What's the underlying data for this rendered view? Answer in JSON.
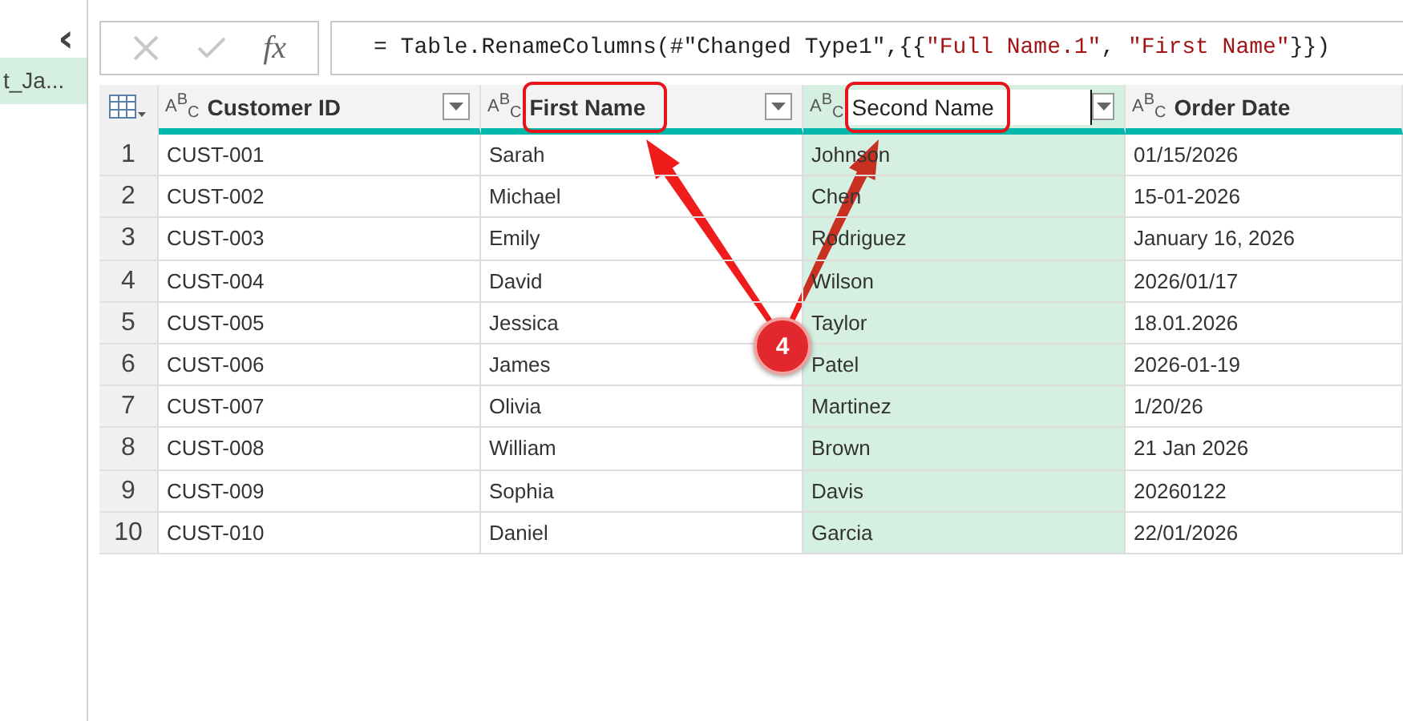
{
  "queries_pane": {
    "collapse_button": "‹",
    "items": [
      {
        "label": "t_Ja...",
        "selected": true
      }
    ]
  },
  "formula_bar": {
    "cancel": {
      "disabled": true
    },
    "commit": {
      "disabled": true
    },
    "fx_label": "fx",
    "formula": [
      {
        "kind": "code",
        "text": "= Table.RenameColumns(#\"Changed Type1\",{{"
      },
      {
        "kind": "string",
        "text": "\"Full Name.1\""
      },
      {
        "kind": "code",
        "text": ", "
      },
      {
        "kind": "string",
        "text": "\"First Name\""
      },
      {
        "kind": "code",
        "text": "}})"
      }
    ]
  },
  "table": {
    "columns": [
      {
        "name": "Customer ID",
        "type": "A$^{B}$$_{C}$",
        "selected": false,
        "editing": false,
        "highlighted": false
      },
      {
        "name": "First Name",
        "type": "A$^{B}$$_{C}$",
        "selected": false,
        "editing": false,
        "highlighted": true
      },
      {
        "name": "Second Name",
        "type": "A$^{B}$$_{C}$",
        "selected": true,
        "editing": true,
        "highlighted": true
      },
      {
        "name": "Order Date",
        "type": "A$^{B}$$_{C}$",
        "selected": false,
        "editing": false,
        "highlighted": false
      }
    ],
    "rows": [
      {
        "number": "1",
        "cells": [
          "CUST-001",
          "Sarah",
          "Johnson",
          "01/15/2026"
        ]
      },
      {
        "number": "2",
        "cells": [
          "CUST-002",
          "Michael",
          "Chen",
          "15-01-2026"
        ]
      },
      {
        "number": "3",
        "cells": [
          "CUST-003",
          "Emily",
          "Rodriguez",
          "January 16, 2026"
        ]
      },
      {
        "number": "4",
        "cells": [
          "CUST-004",
          "David",
          "Wilson",
          "2026/01/17"
        ]
      },
      {
        "number": "5",
        "cells": [
          "CUST-005",
          "Jessica",
          "Taylor",
          "18.01.2026"
        ]
      },
      {
        "number": "6",
        "cells": [
          "CUST-006",
          "James",
          "Patel",
          "2026-01-19"
        ]
      },
      {
        "number": "7",
        "cells": [
          "CUST-007",
          "Olivia",
          "Martinez",
          "1/20/26"
        ]
      },
      {
        "number": "8",
        "cells": [
          "CUST-008",
          "William",
          "Brown",
          "21 Jan 2026"
        ]
      },
      {
        "number": "9",
        "cells": [
          "CUST-009",
          "Sophia",
          "Davis",
          "20260122"
        ]
      },
      {
        "number": "10",
        "cells": [
          "CUST-010",
          "Daniel",
          "Garcia",
          "22/01/2026"
        ]
      }
    ]
  },
  "annotation": {
    "badge": "4"
  }
}
